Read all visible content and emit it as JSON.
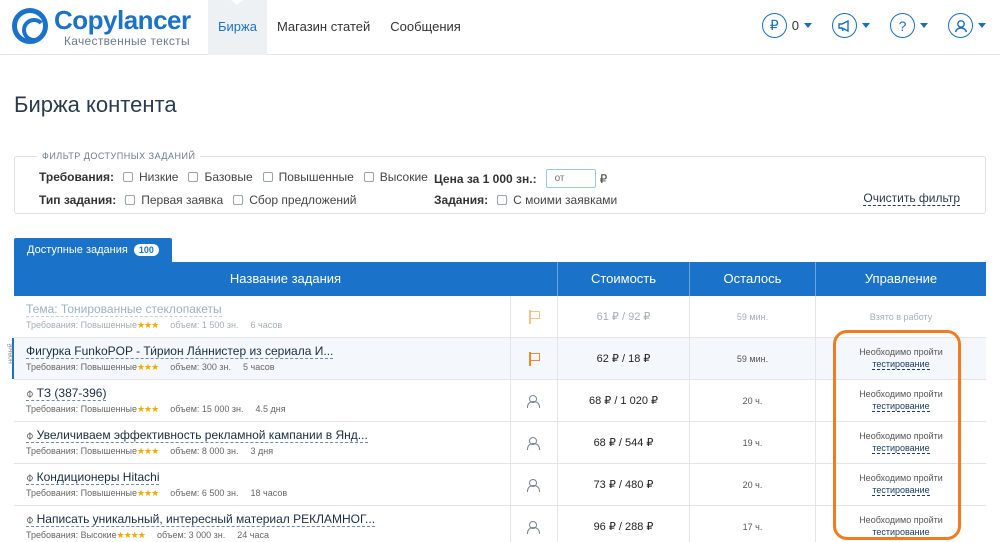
{
  "header": {
    "logo_name": "Copylancer",
    "logo_tagline": "Качественные тексты",
    "nav": [
      {
        "label": "Биржа",
        "active": true
      },
      {
        "label": "Магазин статей",
        "active": false
      },
      {
        "label": "Сообщения",
        "active": false
      }
    ],
    "balance": "0",
    "icons": [
      "ruble-icon",
      "megaphone-icon",
      "help-icon",
      "user-icon"
    ]
  },
  "page": {
    "title": "Биржа контента"
  },
  "filter": {
    "legend": "ФИЛЬТР ДОСТУПНЫХ ЗАДАНИЙ",
    "requirements_label": "Требования:",
    "requirements": [
      "Низкие",
      "Базовые",
      "Повышенные",
      "Высокие"
    ],
    "task_type_label": "Тип задания:",
    "task_types": [
      "Первая заявка",
      "Сбор предложений"
    ],
    "price_label": "Цена за 1 000 зн.:",
    "price_placeholder": "от",
    "currency": "₽",
    "task_label": "Задания:",
    "task_option": "С моими заявками",
    "clear": "Очистить фильтр"
  },
  "tab": {
    "label": "Доступные задания",
    "count": "100"
  },
  "table": {
    "columns": [
      "Название задания",
      "Стоимость",
      "Осталось",
      "Управление"
    ],
    "new_label": "новый",
    "rows": [
      {
        "title": "Тема: Тонированные стеклопакеты",
        "req": "Требования: Повышенные",
        "stars": "★★★",
        "volume": "объем: 1 500 зн.",
        "duration": "6 часов",
        "cost": "61 ₽ / 92 ₽",
        "left": "59 мин.",
        "ctrl_text": "Взято в работу",
        "ctrl_link": "",
        "icon": "flag"
      },
      {
        "title": "Фигурка FunkoPOP - Ти́рион Ла́ннистер из сериала И...",
        "req": "Требования: Повышенные",
        "stars": "★★★",
        "volume": "объем: 300 зн.",
        "duration": "5 часов",
        "cost": "62 ₽ / 18 ₽",
        "left": "59 мин.",
        "ctrl_text": "Необходимо пройти",
        "ctrl_link": "тестирование",
        "icon": "flag"
      },
      {
        "title": "ТЗ (387-396)",
        "req": "Требования: Повышенные",
        "stars": "★★★",
        "volume": "объем: 15 000 зн.",
        "duration": "4.5 дня",
        "cost": "68 ₽ / 1 020 ₽",
        "left": "20 ч.",
        "ctrl_text": "Необходимо пройти",
        "ctrl_link": "тестирование",
        "icon": "users"
      },
      {
        "title": "Увеличиваем эффективность рекламной кампании в Янд...",
        "req": "Требования: Повышенные",
        "stars": "★★★",
        "volume": "объем: 8 000 зн.",
        "duration": "3 дня",
        "cost": "68 ₽ / 544 ₽",
        "left": "19 ч.",
        "ctrl_text": "Необходимо пройти",
        "ctrl_link": "тестирование",
        "icon": "users"
      },
      {
        "title": "Кондиционеры Hitachi",
        "req": "Требования: Повышенные",
        "stars": "★★★",
        "volume": "объем: 6 500 зн.",
        "duration": "18 часов",
        "cost": "73 ₽ / 480 ₽",
        "left": "20 ч.",
        "ctrl_text": "Необходимо пройти",
        "ctrl_link": "тестирование",
        "icon": "users"
      },
      {
        "title": "Написать уникальный, интересный материал РЕКЛАМНОГ...",
        "req": "Требования: Высокие",
        "stars": "★★★★",
        "volume": "объем: 3 000 зн.",
        "duration": "24 часа",
        "cost": "96 ₽ / 288 ₽",
        "left": "17 ч.",
        "ctrl_text": "Необходимо пройти",
        "ctrl_link": "тестирование",
        "icon": "users"
      }
    ]
  }
}
